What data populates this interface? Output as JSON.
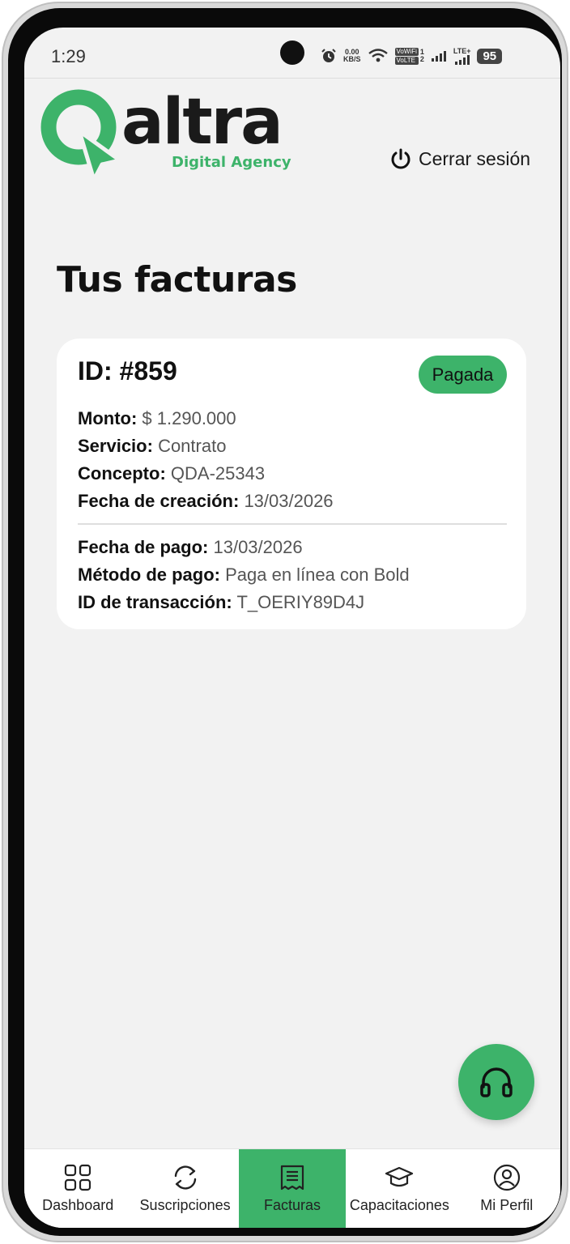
{
  "status_bar": {
    "time": "1:29",
    "net_speed_top": "0.00",
    "net_speed_bottom": "KB/S",
    "vowifi": "VoWiFi",
    "volte": "VoLTE",
    "sim1": "1",
    "sim2": "2",
    "lte": "LTE+",
    "battery": "95",
    "icons": [
      "alarm-icon",
      "wifi-icon",
      "signal-icon",
      "battery-icon"
    ]
  },
  "header": {
    "logo_word": "Qaltra",
    "logo_tagline": "Digital Agency",
    "logout_label": "Cerrar sesión"
  },
  "page_title": "Tus facturas",
  "invoice": {
    "id": "ID: #859",
    "status": "Pagada",
    "amount_label": "Monto:",
    "amount": "$ 1.290.000",
    "service_label": "Servicio:",
    "service": "Contrato",
    "concept_label": "Concepto:",
    "concept": "QDA-25343",
    "created_label": "Fecha de creación:",
    "created": "13/03/2026",
    "paid_label": "Fecha de pago:",
    "paid": "13/03/2026",
    "method_label": "Método de pago:",
    "method": "Paga en línea con Bold",
    "transaction_label": "ID de transacción:",
    "transaction": "T_OERIY89D4J"
  },
  "fab": {
    "icon": "headphones-icon"
  },
  "nav": {
    "items": [
      {
        "label": "Dashboard",
        "icon": "grid-icon",
        "active": false
      },
      {
        "label": "Suscripciones",
        "icon": "refresh-icon",
        "active": false
      },
      {
        "label": "Facturas",
        "icon": "receipt-icon",
        "active": true
      },
      {
        "label": "Capacitaciones",
        "icon": "graduation-cap-icon",
        "active": false
      },
      {
        "label": "Mi Perfil",
        "icon": "user-circle-icon",
        "active": false
      }
    ]
  },
  "colors": {
    "accent": "#3db36a",
    "background": "#f2f2f2",
    "card": "#ffffff",
    "text_dark": "#111111",
    "text_muted": "#555555"
  }
}
